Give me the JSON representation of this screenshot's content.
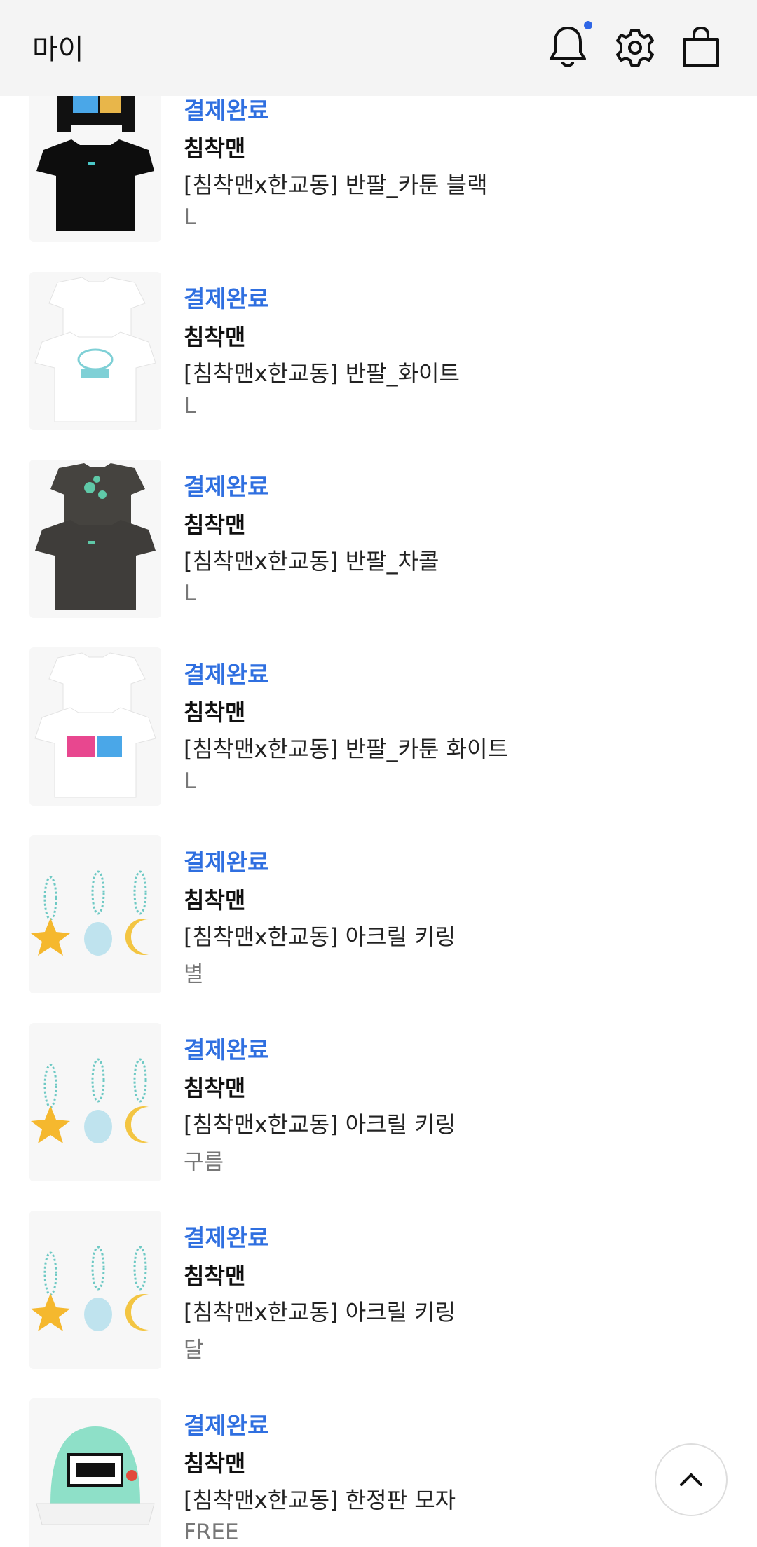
{
  "header": {
    "title": "마이",
    "icons": [
      "bell-icon",
      "gear-icon",
      "shopping-bag-icon"
    ],
    "notification_dot_color": "#2f66e6"
  },
  "colors": {
    "status": "#2f6fe0",
    "header_bg": "#f4f4f4"
  },
  "orders": [
    {
      "status": "결제완료",
      "brand": "침착맨",
      "product": "[침착맨x한교동] 반팔_카툰 블랙",
      "option": "L",
      "thumb": "tshirt-black"
    },
    {
      "status": "결제완료",
      "brand": "침착맨",
      "product": "[침착맨x한교동] 반팔_화이트",
      "option": "L",
      "thumb": "tshirt-white"
    },
    {
      "status": "결제완료",
      "brand": "침착맨",
      "product": "[침착맨x한교동] 반팔_차콜",
      "option": "L",
      "thumb": "tshirt-charcoal"
    },
    {
      "status": "결제완료",
      "brand": "침착맨",
      "product": "[침착맨x한교동] 반팔_카툰 화이트",
      "option": "L",
      "thumb": "tshirt-white-cartoon"
    },
    {
      "status": "결제완료",
      "brand": "침착맨",
      "product": "[침착맨x한교동] 아크릴 키링",
      "option": "별",
      "thumb": "keyring"
    },
    {
      "status": "결제완료",
      "brand": "침착맨",
      "product": "[침착맨x한교동] 아크릴 키링",
      "option": "구름",
      "thumb": "keyring"
    },
    {
      "status": "결제완료",
      "brand": "침착맨",
      "product": "[침착맨x한교동] 아크릴 키링",
      "option": "달",
      "thumb": "keyring"
    },
    {
      "status": "결제완료",
      "brand": "침착맨",
      "product": "[침착맨x한교동] 한정판 모자",
      "option": "FREE",
      "thumb": "cap"
    }
  ],
  "scroll_top": {
    "icon": "chevron-up-icon"
  }
}
